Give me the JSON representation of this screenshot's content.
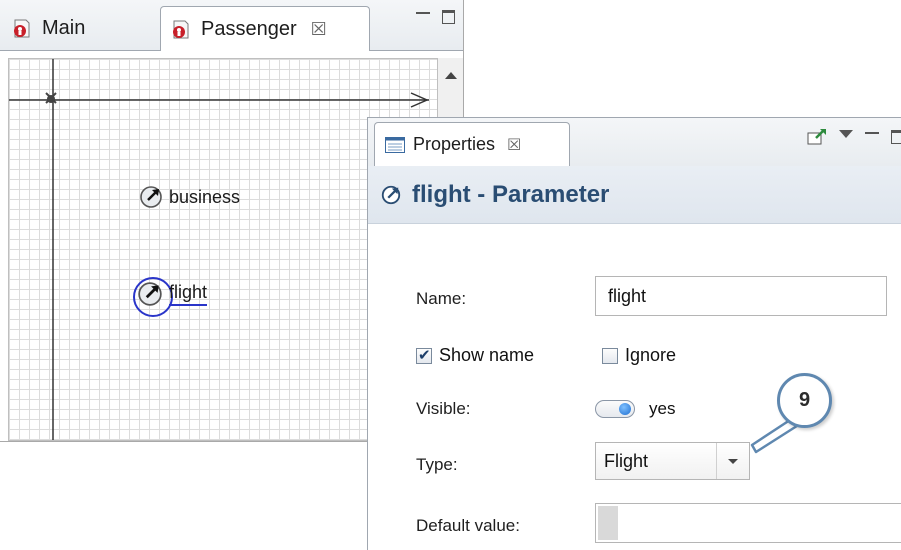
{
  "editor": {
    "tabs": [
      {
        "label": "Main",
        "icon": "agent-icon"
      },
      {
        "label": "Passenger",
        "icon": "agent-icon",
        "close": "☒"
      }
    ],
    "canvas": {
      "params": [
        {
          "label": "business",
          "icon": "parameter-icon"
        },
        {
          "label": "flight",
          "icon": "parameter-icon",
          "selected": true
        }
      ]
    }
  },
  "properties": {
    "tab_label": "Properties",
    "tab_close": "☒",
    "header_title": "flight - Parameter",
    "name_label": "Name:",
    "name_value": "flight",
    "show_name_label": "Show name",
    "show_name_checked": true,
    "ignore_label": "Ignore",
    "ignore_checked": false,
    "visible_label": "Visible:",
    "visible_value": "yes",
    "type_label": "Type:",
    "type_value": "Flight",
    "default_label": "Default value:"
  },
  "callout": {
    "number": "9"
  },
  "colors": {
    "header_text": "#2a4d73",
    "selection": "#2a35c9",
    "callout_border": "#5f88b0"
  }
}
